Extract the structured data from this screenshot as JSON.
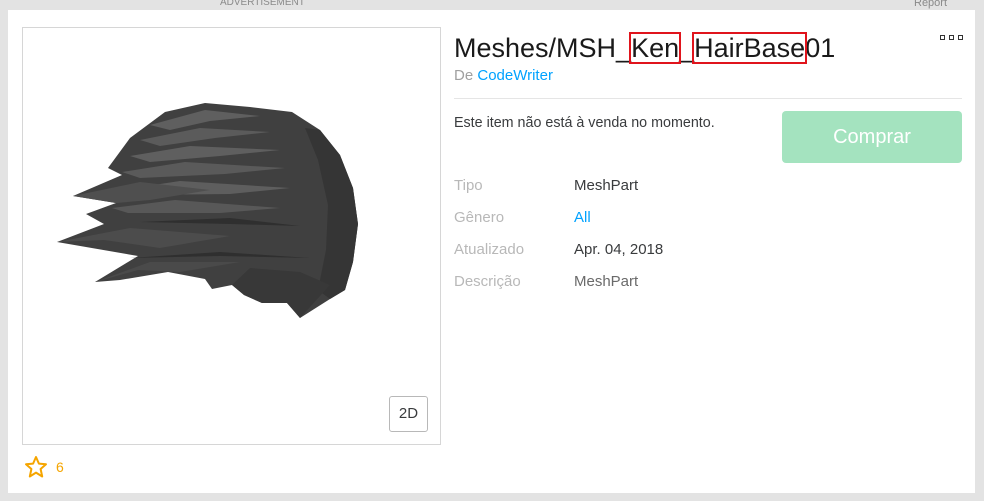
{
  "top_bar": {
    "advertisement": "ADVERTISEMENT",
    "report": "Report"
  },
  "item": {
    "title": "Meshes/MSH_Ken_HairBase01",
    "title_highlights": [
      "Ken",
      "HairBase"
    ],
    "byline_prefix": "De",
    "creator": "CodeWriter",
    "sale_status": "Este item não está à venda no momento.",
    "buy_button": "Comprar",
    "details": [
      {
        "label": "Tipo",
        "value": "MeshPart"
      },
      {
        "label": "Gênero",
        "value": "All"
      },
      {
        "label": "Atualizado",
        "value": "Apr. 04, 2018"
      },
      {
        "label": "Descrição",
        "value": "MeshPart"
      }
    ]
  },
  "thumbnail": {
    "image": "hair-mesh-render",
    "toggle_label": "2D"
  },
  "favorites": {
    "icon": "star-icon",
    "count": "6"
  },
  "menu": {
    "icon": "more-options-icon"
  },
  "colors": {
    "link": "#00a2ff",
    "buy_disabled": "#a4e3bf",
    "favorite": "#f5a500",
    "highlight_box": "#e0141c",
    "page_background": "#e3e3e3"
  }
}
